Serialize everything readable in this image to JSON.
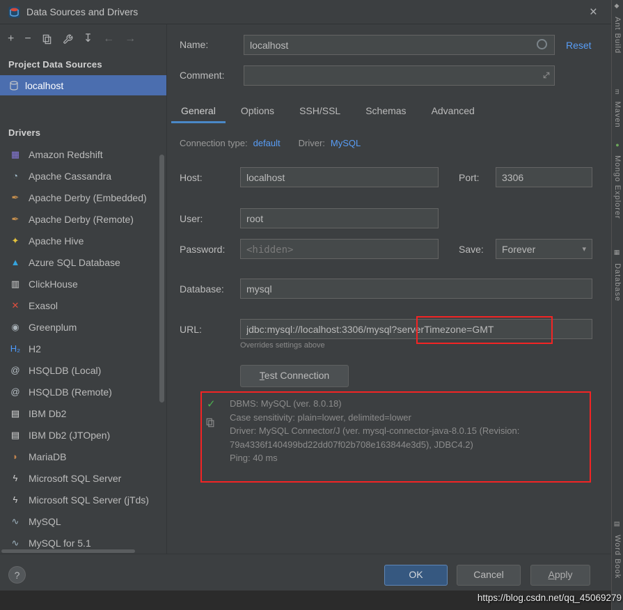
{
  "window": {
    "title": "Data Sources and Drivers",
    "close_glyph": "×"
  },
  "toolbar": {
    "icon_names": [
      "add-icon",
      "remove-icon",
      "copy-icon",
      "wrench-icon",
      "import-icon",
      "back-icon",
      "forward-icon"
    ],
    "add_glyph": "+",
    "remove_glyph": "−",
    "import_glyph": "↧",
    "back_glyph": "←",
    "forward_glyph": "→"
  },
  "sidebar": {
    "project_header": "Project Data Sources",
    "datasource_label": "localhost",
    "drivers_header": "Drivers",
    "drivers": [
      {
        "label": "Amazon Redshift",
        "icon": "amazon-redshift-icon",
        "glyph": "▦",
        "color": "#8577d6"
      },
      {
        "label": "Apache Cassandra",
        "icon": "apache-cassandra-icon",
        "glyph": "◔",
        "color": "#9fb8c8"
      },
      {
        "label": "Apache Derby (Embedded)",
        "icon": "apache-derby-embedded-icon",
        "glyph": "✒",
        "color": "#c9914e"
      },
      {
        "label": "Apache Derby (Remote)",
        "icon": "apache-derby-remote-icon",
        "glyph": "✒",
        "color": "#c9914e"
      },
      {
        "label": "Apache Hive",
        "icon": "apache-hive-icon",
        "glyph": "✦",
        "color": "#e3c23c"
      },
      {
        "label": "Azure SQL Database",
        "icon": "azure-sql-database-icon",
        "glyph": "▲",
        "color": "#35a3dc"
      },
      {
        "label": "ClickHouse",
        "icon": "clickhouse-icon",
        "glyph": "▥",
        "color": "#cfcfcf"
      },
      {
        "label": "Exasol",
        "icon": "exasol-icon",
        "glyph": "✕",
        "color": "#e04f3f"
      },
      {
        "label": "Greenplum",
        "icon": "greenplum-icon",
        "glyph": "◉",
        "color": "#a9b2b8"
      },
      {
        "label": "H2",
        "icon": "h2-icon",
        "glyph": "H₂",
        "color": "#4d9bff"
      },
      {
        "label": "HSQLDB (Local)",
        "icon": "hsqldb-local-icon",
        "glyph": "@",
        "color": "#b8c0c6"
      },
      {
        "label": "HSQLDB (Remote)",
        "icon": "hsqldb-remote-icon",
        "glyph": "@",
        "color": "#b8c0c6"
      },
      {
        "label": "IBM Db2",
        "icon": "ibm-db2-icon",
        "glyph": "▤",
        "color": "#d6d6d6"
      },
      {
        "label": "IBM Db2 (JTOpen)",
        "icon": "ibm-db2-jtopen-icon",
        "glyph": "▤",
        "color": "#d6d6d6"
      },
      {
        "label": "MariaDB",
        "icon": "mariadb-icon",
        "glyph": "◗",
        "color": "#c0834f"
      },
      {
        "label": "Microsoft SQL Server",
        "icon": "microsoft-sql-server-icon",
        "glyph": "ϟ",
        "color": "#cfcfcf"
      },
      {
        "label": "Microsoft SQL Server (jTds)",
        "icon": "microsoft-sql-server-jtds-icon",
        "glyph": "ϟ",
        "color": "#cfcfcf"
      },
      {
        "label": "MySQL",
        "icon": "mysql-icon",
        "glyph": "∿",
        "color": "#9fb4c0"
      },
      {
        "label": "MySQL for 5.1",
        "icon": "mysql-51-icon",
        "glyph": "∿",
        "color": "#9fb4c0"
      }
    ]
  },
  "form": {
    "name_label": "Name:",
    "name_value": "localhost",
    "reset_label": "Reset",
    "comment_label": "Comment:",
    "comment_value": "",
    "tabs": [
      {
        "label": "General",
        "name": "tab-general",
        "cls": "active"
      },
      {
        "label": "Options",
        "name": "tab-options"
      },
      {
        "label": "SSH/SSL",
        "name": "tab-ssh-ssl"
      },
      {
        "label": "Schemas",
        "name": "tab-schemas"
      },
      {
        "label": "Advanced",
        "name": "tab-advanced"
      }
    ],
    "connection_type_label": "Connection type:",
    "connection_type_value": "default",
    "driver_label": "Driver:",
    "driver_value": "MySQL",
    "host_label": "Host:",
    "host_value": "localhost",
    "port_label": "Port:",
    "port_value": "3306",
    "user_label": "User:",
    "user_value": "root",
    "password_label": "Password:",
    "password_placeholder": "<hidden>",
    "save_label": "Save:",
    "save_value": "Forever",
    "database_label": "Database:",
    "database_value": "mysql",
    "url_label": "URL:",
    "url_value": "jdbc:mysql://localhost:3306/mysql?serverTimezone=GMT",
    "url_note": "Overrides settings above",
    "test_button": "Test Connection"
  },
  "result": {
    "lines": [
      "DBMS: MySQL (ver. 8.0.18)",
      "Case sensitivity: plain=lower, delimited=lower",
      "Driver: MySQL Connector/J (ver. mysql-connector-java-8.0.15 (Revision: 79a4336f140499bd22dd07f02b708e163844e3d5), JDBC4.2)",
      "Ping: 40 ms"
    ]
  },
  "footer": {
    "help": "?",
    "ok": "OK",
    "cancel": "Cancel",
    "apply": "Apply"
  },
  "right_strip": {
    "items": [
      {
        "label": "Ant Build",
        "name": "toolwindow-ant-build",
        "icon": "ant-build-icon",
        "glyph": "◆",
        "icon_color": "#9b9b9b"
      },
      {
        "label": "Maven",
        "name": "toolwindow-maven",
        "icon": "maven-icon",
        "glyph": "m",
        "icon_color": "#9b9b9b"
      },
      {
        "label": "Mongo Explorer",
        "name": "toolwindow-mongo-explorer",
        "icon": "mongo-explorer-icon",
        "glyph": "●",
        "icon_color": "#6ca75a"
      },
      {
        "label": "Database",
        "name": "toolwindow-database",
        "icon": "database-icon",
        "glyph": "▦",
        "icon_color": "#9b9b9b"
      },
      {
        "label": "Word Book",
        "name": "toolwindow-word-book",
        "icon": "word-book-icon",
        "glyph": "▤",
        "icon_color": "#9b9b9b"
      }
    ]
  },
  "watermark": "https://blog.csdn.net/qq_45069279",
  "icons": {
    "dropdown_arrow": "▾",
    "check": "✓"
  },
  "colors": {
    "selection": "#4b6eaf",
    "link": "#589df6",
    "tab_underline": "#4a88c7",
    "ok_button": "#365880",
    "annotation_red": "#f32424",
    "success_green": "#4db050"
  }
}
